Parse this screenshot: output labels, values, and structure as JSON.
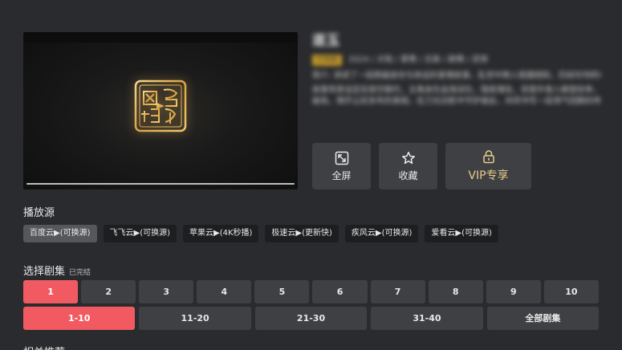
{
  "info": {
    "title": "逐玉",
    "badge": "已完结",
    "meta": "2024 / 大陆 / 爱情 / 古装 / 剧情 / 武侠",
    "desc_lines": [
      "简介: 讲述了一段跨越身份与命运的爱情故事，乱世中两人相遇相知，历经坎坷终成眷属的传奇故事。",
      "故事背景设定在架空朝代，主角身负血海深仇，隐姓埋名，却意外卷入朝堂纷争，与女主携手",
      "破局，揭开尘封多年的真相，在刀光剑影中守护彼此，共同书写一段荡气回肠的传奇。"
    ]
  },
  "actions": {
    "fullscreen": "全屏",
    "favorite": "收藏",
    "vip": "VIP专享"
  },
  "player": {
    "progress": 1.0
  },
  "sources": {
    "title": "播放源",
    "items": [
      "百度云▶(可换源)",
      "飞飞云▶(可换源)",
      "苹果云▶(4K秒播)",
      "极速云▶(更新快)",
      "疾风云▶(可换源)",
      "爱看云▶(可换源)"
    ],
    "active_index": 0
  },
  "episodes": {
    "title": "选择剧集",
    "status": "已完结",
    "items": [
      "1",
      "2",
      "3",
      "4",
      "5",
      "6",
      "7",
      "8",
      "9",
      "10"
    ],
    "active_index": 0,
    "ranges": [
      "1-10",
      "11-20",
      "21-30",
      "31-40",
      "全部剧集"
    ],
    "active_range": 0
  },
  "related": {
    "title": "相关推荐"
  },
  "colors": {
    "accent": "#f25a62",
    "vip_gold": "#e8cd8a",
    "background": "#2a2b2e",
    "button": "#3e4043"
  }
}
